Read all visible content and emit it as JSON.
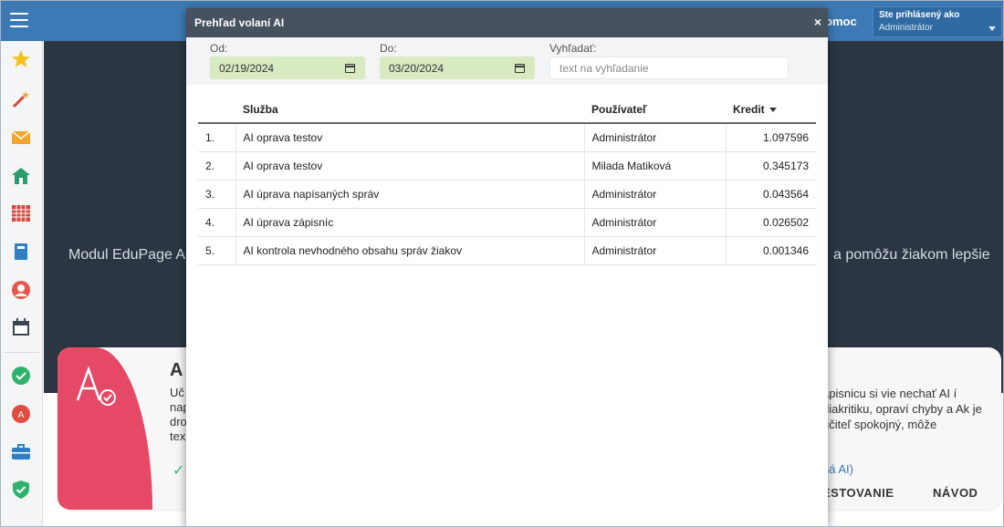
{
  "topbar": {
    "help_label": "omoc",
    "user_line1": "Ste prihlásený ako",
    "user_line2": "Administrátor"
  },
  "sidebar": {
    "icons": [
      "star-icon",
      "magic-wand-icon",
      "envelope-icon",
      "home-icon",
      "timetable-icon",
      "book-icon",
      "user-icon",
      "calendar-icon",
      "check-circle-icon",
      "ai-badge-icon",
      "briefcase-icon",
      "shield-check-icon"
    ]
  },
  "background": {
    "text_left": "Modul EduPage A",
    "text_right": "a pomôžu žiakom lepšie"
  },
  "card": {
    "title": "A",
    "left_text": "Uč nap dro tex",
    "right_text": "ápisnicu si vie nechať AI í diakritiku, opraví chyby a Ak je učiteľ spokojný, môže",
    "link": "ná AI)",
    "btn_testing": "ESTOVANIE",
    "btn_guide": "NÁVOD"
  },
  "modal": {
    "title": "Prehľad volaní AI",
    "close_label": "×",
    "filters": {
      "from_label": "Od:",
      "from_value": "02/19/2024",
      "to_label": "Do:",
      "to_value": "03/20/2024",
      "search_label": "Vyhľadať:",
      "search_placeholder": "text na vyhľadanie"
    },
    "table": {
      "headers": {
        "service": "Služba",
        "user": "Používateľ",
        "credit": "Kredit"
      },
      "rows": [
        {
          "num": "1.",
          "service": "AI oprava testov",
          "user": "Administrátor",
          "credit": "1.097596"
        },
        {
          "num": "2.",
          "service": "AI oprava testov",
          "user": "Milada Matiková",
          "credit": "0.345173"
        },
        {
          "num": "3.",
          "service": "AI úprava napísaných správ",
          "user": "Administrátor",
          "credit": "0.043564"
        },
        {
          "num": "4.",
          "service": "AI úprava zápisníc",
          "user": "Administrátor",
          "credit": "0.026502"
        },
        {
          "num": "5.",
          "service": "AI kontrola nevhodného obsahu správ žiakov",
          "user": "Administrátor",
          "credit": "0.001346"
        }
      ]
    }
  }
}
